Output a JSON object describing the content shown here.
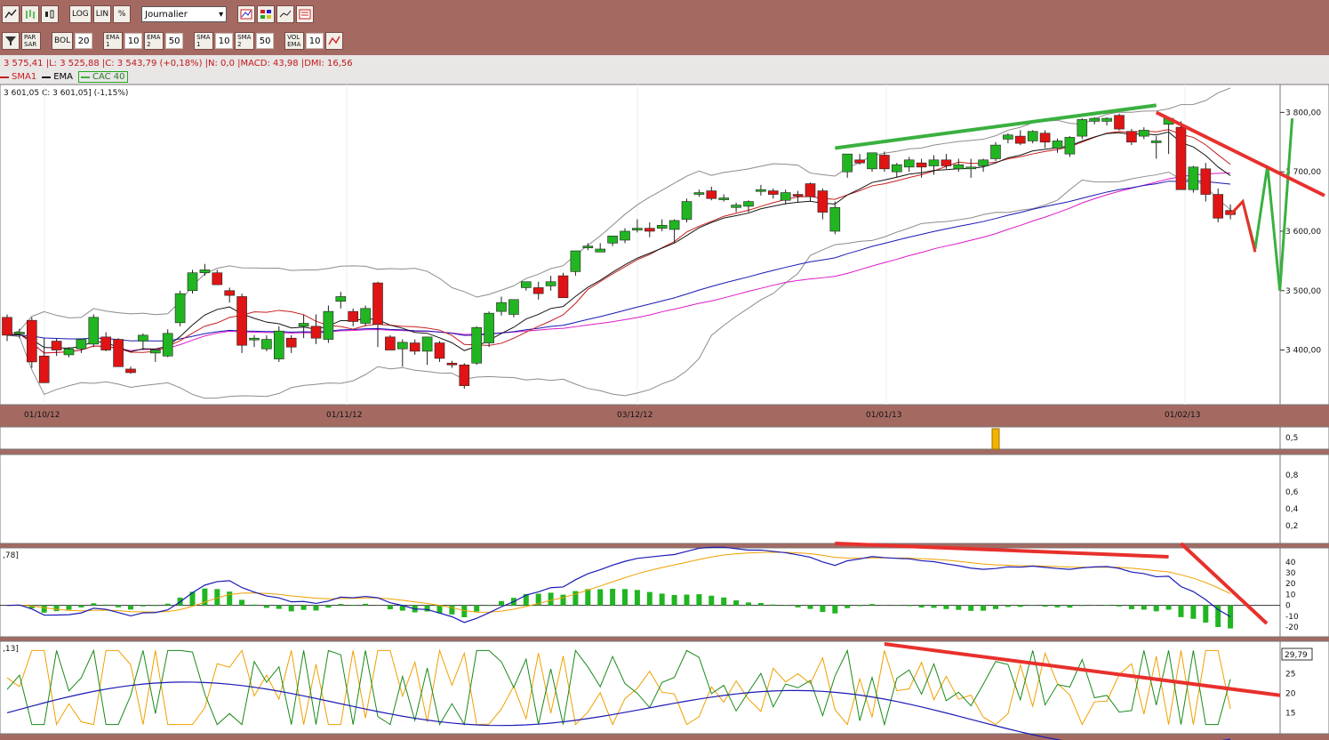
{
  "toolbar1": {
    "log_label": "LOG",
    "lin_label": "LIN",
    "pct_label": "%",
    "period_select": "Journalier"
  },
  "toolbar2": {
    "par_sar": "PAR SAR",
    "bol": "BOL",
    "bol_value": "20",
    "ema1": "EMA 1",
    "ema1_value": "10",
    "ema2": "EMA 2",
    "ema2_value": "50",
    "sma1": "SMA 1",
    "sma1_value": "10",
    "sma2": "SMA 2",
    "sma2_value": "50",
    "vol_ema": "VOL EMA",
    "vol_ema_value": "10"
  },
  "info": {
    "line1": "3 575,41 |L: 3 525,88 |C: 3 543,79 (+0,18%) |N: 0,0 |MACD: 43,98 |DMI: 16,56",
    "legend_sma1": "SMA1",
    "legend_ema": "EMA",
    "legend_cac": "CAC 40",
    "line3": "3 601,05  C: 3 601,05] (-1,15%)"
  },
  "colors": {
    "up": "#22b522",
    "down": "#e01414",
    "bollinger": "#8c8c8c",
    "sma": "#c81e1e",
    "ema": "#141414",
    "ema50": "#1919b4",
    "sma50": "#dc19c8",
    "trend_red": "#e8302c",
    "trend_green": "#3ab040",
    "macd": "#1a1ab4",
    "signal": "#f0a000",
    "dmi_plus": "#1a8a1a",
    "volume_bar": "#f2b200"
  },
  "chart_data": [
    {
      "type": "candlestick",
      "x_ticks": [
        "01/10/12",
        "01/11/12",
        "03/12/12",
        "01/01/13",
        "01/02/13"
      ],
      "y_ticks": [
        3400,
        3500,
        3600,
        3700,
        3800
      ],
      "y_tick_labels": [
        "3 400,00",
        "3 500,00",
        "3 600,00",
        "3 700,00",
        "3 800,00"
      ],
      "ylim": [
        3320,
        3835
      ],
      "candles": [
        [
          3455,
          3460,
          3415,
          3425
        ],
        [
          3430,
          3436,
          3420,
          3430
        ],
        [
          3450,
          3455,
          3370,
          3380
        ],
        [
          3390,
          3420,
          3345,
          3345
        ],
        [
          3415,
          3420,
          3390,
          3400
        ],
        [
          3392,
          3405,
          3388,
          3402
        ],
        [
          3402,
          3418,
          3395,
          3418
        ],
        [
          3410,
          3460,
          3405,
          3455
        ],
        [
          3422,
          3430,
          3398,
          3400
        ],
        [
          3418,
          3420,
          3375,
          3372
        ],
        [
          3368,
          3372,
          3360,
          3362
        ],
        [
          3415,
          3428,
          3400,
          3425
        ],
        [
          3395,
          3400,
          3380,
          3400
        ],
        [
          3390,
          3435,
          3388,
          3428
        ],
        [
          3446,
          3500,
          3440,
          3495
        ],
        [
          3500,
          3535,
          3495,
          3530
        ],
        [
          3530,
          3545,
          3525,
          3535
        ],
        [
          3530,
          3535,
          3510,
          3510
        ],
        [
          3500,
          3505,
          3480,
          3492
        ],
        [
          3490,
          3495,
          3395,
          3408
        ],
        [
          3420,
          3425,
          3405,
          3420
        ],
        [
          3402,
          3425,
          3398,
          3418
        ],
        [
          3385,
          3440,
          3380,
          3432
        ],
        [
          3420,
          3425,
          3395,
          3405
        ],
        [
          3440,
          3460,
          3420,
          3445
        ],
        [
          3440,
          3460,
          3410,
          3420
        ],
        [
          3418,
          3475,
          3412,
          3465
        ],
        [
          3482,
          3498,
          3470,
          3490
        ],
        [
          3465,
          3470,
          3440,
          3448
        ],
        [
          3445,
          3475,
          3440,
          3470
        ],
        [
          3513,
          3515,
          3405,
          3443
        ],
        [
          3422,
          3425,
          3402,
          3400
        ],
        [
          3402,
          3418,
          3372,
          3413
        ],
        [
          3412,
          3418,
          3392,
          3398
        ],
        [
          3398,
          3418,
          3375,
          3422
        ],
        [
          3412,
          3415,
          3380,
          3386
        ],
        [
          3378,
          3382,
          3370,
          3375
        ],
        [
          3375,
          3378,
          3335,
          3340
        ],
        [
          3378,
          3440,
          3375,
          3438
        ],
        [
          3412,
          3465,
          3405,
          3462
        ],
        [
          3465,
          3490,
          3458,
          3480
        ],
        [
          3460,
          3480,
          3455,
          3485
        ],
        [
          3505,
          3515,
          3500,
          3515
        ],
        [
          3505,
          3515,
          3485,
          3495
        ],
        [
          3508,
          3525,
          3500,
          3515
        ],
        [
          3525,
          3530,
          3495,
          3488
        ],
        [
          3532,
          3565,
          3525,
          3567
        ],
        [
          3572,
          3580,
          3568,
          3575
        ],
        [
          3565,
          3580,
          3565,
          3570
        ],
        [
          3580,
          3590,
          3575,
          3592
        ],
        [
          3585,
          3605,
          3580,
          3600
        ],
        [
          3605,
          3620,
          3598,
          3605
        ],
        [
          3605,
          3615,
          3590,
          3600
        ],
        [
          3605,
          3620,
          3600,
          3610
        ],
        [
          3603,
          3620,
          3580,
          3618
        ],
        [
          3620,
          3655,
          3615,
          3650
        ],
        [
          3665,
          3670,
          3658,
          3665
        ],
        [
          3668,
          3675,
          3652,
          3655
        ],
        [
          3656,
          3662,
          3650,
          3656
        ],
        [
          3640,
          3648,
          3632,
          3644
        ],
        [
          3642,
          3652,
          3632,
          3650
        ],
        [
          3668,
          3678,
          3660,
          3670
        ],
        [
          3668,
          3672,
          3655,
          3662
        ],
        [
          3652,
          3670,
          3645,
          3665
        ],
        [
          3662,
          3668,
          3648,
          3660
        ],
        [
          3680,
          3682,
          3650,
          3658
        ],
        [
          3668,
          3672,
          3620,
          3632
        ],
        [
          3600,
          3650,
          3595,
          3640
        ],
        [
          3700,
          3725,
          3690,
          3730
        ],
        [
          3720,
          3730,
          3712,
          3715
        ],
        [
          3705,
          3730,
          3700,
          3732
        ],
        [
          3728,
          3734,
          3700,
          3705
        ],
        [
          3700,
          3715,
          3690,
          3712
        ],
        [
          3708,
          3725,
          3700,
          3720
        ],
        [
          3715,
          3722,
          3690,
          3708
        ],
        [
          3710,
          3728,
          3695,
          3720
        ],
        [
          3720,
          3730,
          3705,
          3710
        ],
        [
          3705,
          3722,
          3700,
          3712
        ],
        [
          3705,
          3722,
          3690,
          3708
        ],
        [
          3710,
          3722,
          3700,
          3720
        ],
        [
          3722,
          3750,
          3718,
          3745
        ],
        [
          3755,
          3765,
          3748,
          3762
        ],
        [
          3760,
          3770,
          3745,
          3748
        ],
        [
          3752,
          3770,
          3748,
          3768
        ],
        [
          3765,
          3770,
          3740,
          3750
        ],
        [
          3740,
          3756,
          3732,
          3752
        ],
        [
          3730,
          3760,
          3725,
          3758
        ],
        [
          3760,
          3790,
          3755,
          3788
        ],
        [
          3785,
          3792,
          3780,
          3790
        ],
        [
          3785,
          3792,
          3778,
          3790
        ],
        [
          3795,
          3798,
          3770,
          3772
        ],
        [
          3768,
          3772,
          3745,
          3750
        ],
        [
          3760,
          3775,
          3755,
          3770
        ],
        [
          3750,
          3760,
          3722,
          3752
        ],
        [
          3780,
          3790,
          3730,
          3790
        ],
        [
          3775,
          3785,
          3670,
          3670
        ],
        [
          3670,
          3710,
          3665,
          3708
        ],
        [
          3705,
          3715,
          3650,
          3662
        ],
        [
          3662,
          3672,
          3615,
          3622
        ],
        [
          3635,
          3645,
          3620,
          3628
        ]
      ]
    },
    {
      "type": "bar",
      "label": "volume",
      "y_tick_labels": [
        "0,5"
      ]
    },
    {
      "type": "line",
      "label": "empty panel",
      "y_tick_labels": [
        "0,8",
        "0,6",
        "0,4",
        "0,2"
      ]
    },
    {
      "type": "line",
      "label": "MACD",
      "header": ",78]",
      "y_ticks": [
        40,
        30,
        20,
        10,
        0,
        -10,
        -20
      ],
      "y_tick_labels": [
        "40",
        "30",
        "20",
        "10",
        "0",
        "-10",
        "-20"
      ],
      "ylim": [
        -24,
        48
      ]
    },
    {
      "type": "line",
      "label": "DMI",
      "header": ",13]",
      "value_box": "29,79",
      "y_ticks": [
        25,
        20,
        15
      ],
      "y_tick_labels": [
        "25",
        "20",
        "15"
      ],
      "ylim": [
        11,
        32
      ]
    }
  ]
}
